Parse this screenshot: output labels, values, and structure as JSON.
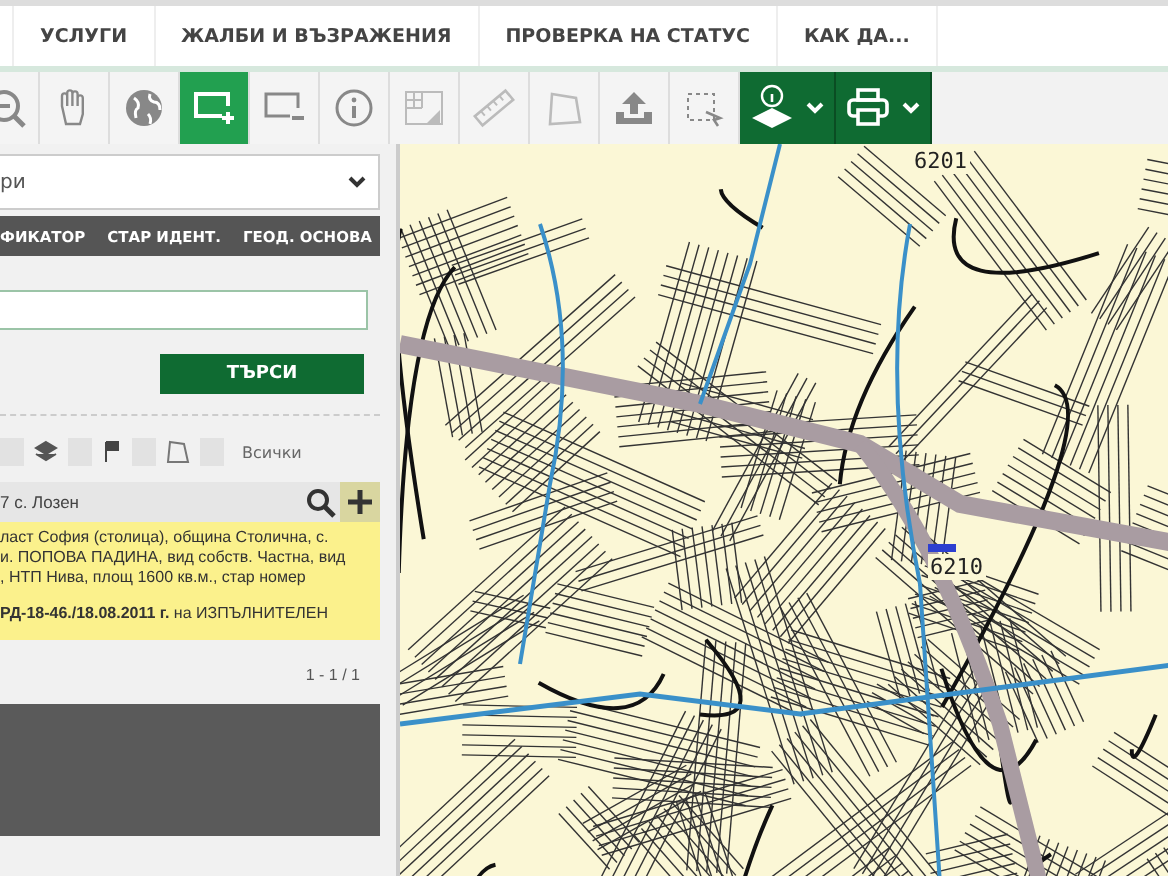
{
  "nav": {
    "items": [
      {
        "label": "УСЛУГИ"
      },
      {
        "label": "ЖАЛБИ И ВЪЗРАЖЕНИЯ"
      },
      {
        "label": "ПРОВЕРКА НА СТАТУС"
      },
      {
        "label": "КАК ДА..."
      }
    ]
  },
  "toolbar": {
    "tools": [
      {
        "kind": "zoom-out",
        "selected": false,
        "disabled": false
      },
      {
        "kind": "hand",
        "selected": false,
        "disabled": false
      },
      {
        "kind": "globe",
        "selected": false,
        "disabled": false
      },
      {
        "kind": "rect-plus",
        "selected": true,
        "disabled": false
      },
      {
        "kind": "rect-minus",
        "selected": false,
        "disabled": false
      },
      {
        "kind": "info",
        "selected": false,
        "disabled": false
      },
      {
        "kind": "grid-ruler",
        "selected": false,
        "disabled": true
      },
      {
        "kind": "ruler",
        "selected": false,
        "disabled": true
      },
      {
        "kind": "polygon",
        "selected": false,
        "disabled": true
      },
      {
        "kind": "upload",
        "selected": false,
        "disabled": false
      },
      {
        "kind": "select",
        "selected": false,
        "disabled": false
      },
      {
        "kind": "layer-info",
        "selected": false,
        "disabled": false
      },
      {
        "kind": "print",
        "selected": false,
        "disabled": false
      }
    ]
  },
  "panel": {
    "dropdown": {
      "value": "ри"
    },
    "tabs": [
      {
        "label": "ФИКАТОР",
        "selected": false
      },
      {
        "label": "СТАР ИДЕНТ.",
        "selected": false
      },
      {
        "label": "ГЕОД. ОСНОВА",
        "selected": false
      }
    ],
    "search_button": "ТЪРСИ",
    "filters": {
      "items": [
        {
          "kind": "checkbox",
          "checked": false
        },
        {
          "kind": "layers"
        },
        {
          "kind": "checkbox",
          "checked": false
        },
        {
          "kind": "flag"
        },
        {
          "kind": "checkbox",
          "checked": false
        },
        {
          "kind": "polygon"
        },
        {
          "kind": "checkbox",
          "checked": false
        }
      ],
      "all_label": "Всички"
    },
    "result": {
      "title": "7 с. Лозен",
      "lines": [
        "ласт София (столица), община Столична, с.",
        "и. ПОПОВА ПАДИНА, вид собств. Частна, вид",
        ", НТП Нива, площ 1600 кв.м., стар номер"
      ],
      "note": "**РД-18-46./18.08.2011 г.** на ИЗПЪЛНИТЕЛЕН"
    },
    "pagination": "1 - 1 / 1"
  },
  "map": {
    "labels": [
      {
        "text": "6201"
      },
      {
        "text": "6210"
      }
    ]
  }
}
